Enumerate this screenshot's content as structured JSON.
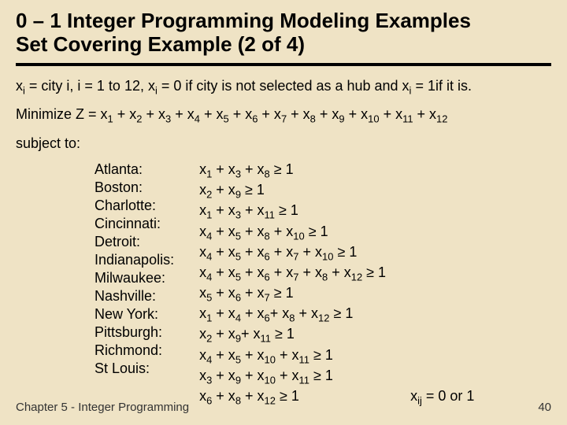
{
  "title_line1": "0 – 1 Integer Programming Modeling Examples",
  "title_line2": "Set Covering Example (2 of 4)",
  "definition_html": "x<sub>i</sub> = city i, i = 1 to 12, x<sub>i</sub> = 0 if city is not selected as a hub and x<sub>i</sub> = 1if it is.",
  "objective_html": "Minimize Z = x<sub>1</sub> + x<sub>2</sub> + x<sub>3</sub> + x<sub>4</sub> + x<sub>5</sub> + x<sub>6</sub> + x<sub>7</sub> + x<sub>8</sub> + x<sub>9</sub> + x<sub>10</sub> + x<sub>11</sub> + x<sub>12</sub>",
  "subject_to": "subject to:",
  "cities": [
    "Atlanta:",
    "Boston:",
    "Charlotte:",
    "Cincinnati:",
    "Detroit:",
    "Indianapolis:",
    "Milwaukee:",
    "Nashville:",
    "New York:",
    "Pittsburgh:",
    "Richmond:",
    "St Louis:"
  ],
  "exprs_html": [
    "x<sub>1</sub> + x<sub>3</sub> + x<sub>8</sub> ≥ 1",
    "x<sub>2</sub>  + x<sub>9</sub>  ≥ 1",
    "x<sub>1</sub> + x<sub>3</sub> + x<sub>11</sub> ≥ 1",
    "x<sub>4</sub> + x<sub>5</sub> + x<sub>8</sub> + x<sub>10</sub> ≥ 1",
    "x<sub>4</sub> + x<sub>5</sub> + x<sub>6</sub> + x<sub>7</sub> + x<sub>10</sub> ≥ 1",
    "x<sub>4</sub> + x<sub>5</sub> + x<sub>6</sub> + x<sub>7</sub> + x<sub>8</sub> + x<sub>12</sub> ≥ 1",
    "x<sub>5</sub> + x<sub>6</sub> + x<sub>7</sub> ≥ 1",
    "x<sub>1</sub> + x<sub>4</sub> + x<sub>6</sub>+ x<sub>8</sub> + x<sub>12</sub> ≥ 1",
    "x<sub>2</sub>  + x<sub>9</sub>+ x<sub>11</sub>  ≥ 1",
    "x<sub>4</sub> + x<sub>5</sub> + x<sub>10</sub> + x<sub>11</sub> ≥ 1",
    "x<sub>3</sub> + x<sub>9</sub> + x<sub>10</sub> + x<sub>11</sub> ≥ 1",
    "x<sub>6</sub> + x<sub>8</sub> + x<sub>12</sub>  ≥ 1"
  ],
  "binary_note_html": "x<sub>ij</sub> = 0 or 1",
  "footer_left": "Chapter 5 - Integer Programming",
  "footer_right": "40"
}
